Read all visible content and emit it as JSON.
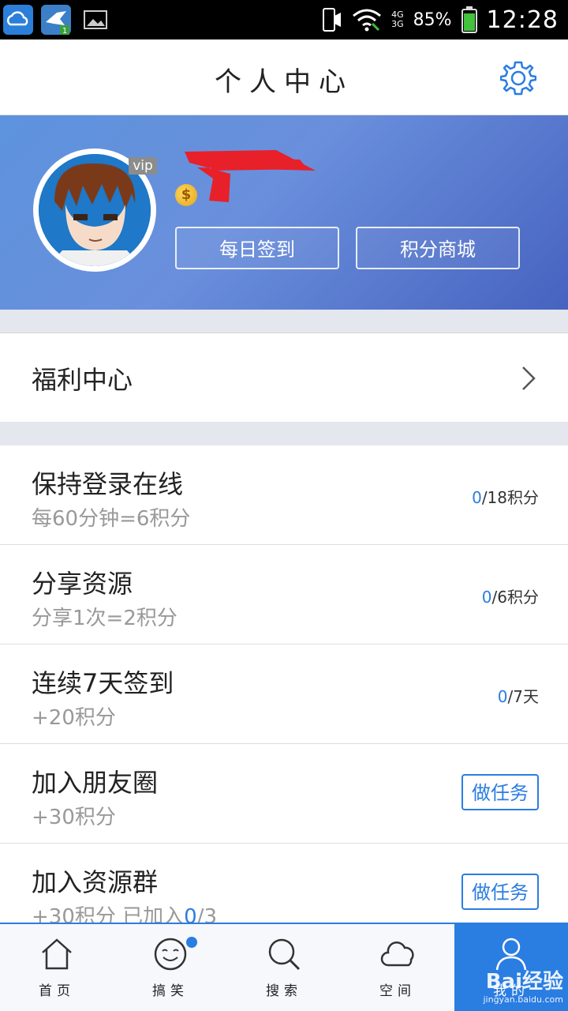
{
  "status_bar": {
    "battery": "85%",
    "time": "12:28",
    "net_top": "4G",
    "net_bottom": "3G",
    "app_icons": [
      "cloud-icon",
      "bird-app-icon",
      "image-icon"
    ]
  },
  "header": {
    "title": "个人中心",
    "settings_icon": "gear-icon"
  },
  "profile": {
    "vip": "vip",
    "coin": "$",
    "checkin_label": "每日签到",
    "mall_label": "积分商城"
  },
  "welfare": {
    "label": "福利中心"
  },
  "tasks": [
    {
      "title": "保持登录在线",
      "desc": "每60分钟=6积分",
      "done": "0",
      "total": "/18积分"
    },
    {
      "title": "分享资源",
      "desc": "分享1次=2积分",
      "done": "0",
      "total": "/6积分"
    },
    {
      "title": "连续7天签到",
      "desc": "+20积分",
      "done": "0",
      "total": "/7天"
    },
    {
      "title": "加入朋友圈",
      "desc": "+30积分",
      "button": "做任务"
    },
    {
      "title": "加入资源群",
      "desc_prefix": "+30积分 已加入",
      "desc_done": "0",
      "desc_total": "/3",
      "button": "做任务"
    }
  ],
  "tabbar": [
    {
      "label": "首页",
      "icon": "home-icon"
    },
    {
      "label": "搞笑",
      "icon": "smile-icon"
    },
    {
      "label": "搜索",
      "icon": "search-icon"
    },
    {
      "label": "空间",
      "icon": "cloud-icon"
    },
    {
      "label": "我的",
      "icon": "user-icon"
    }
  ],
  "watermark": {
    "brand": "Bai经验",
    "url": "jingyan.baidu.com"
  },
  "colors": {
    "accent": "#2a7de1",
    "banner_start": "#5d93dd",
    "banner_end": "#4663c0",
    "separator": "#e5e7ee"
  }
}
